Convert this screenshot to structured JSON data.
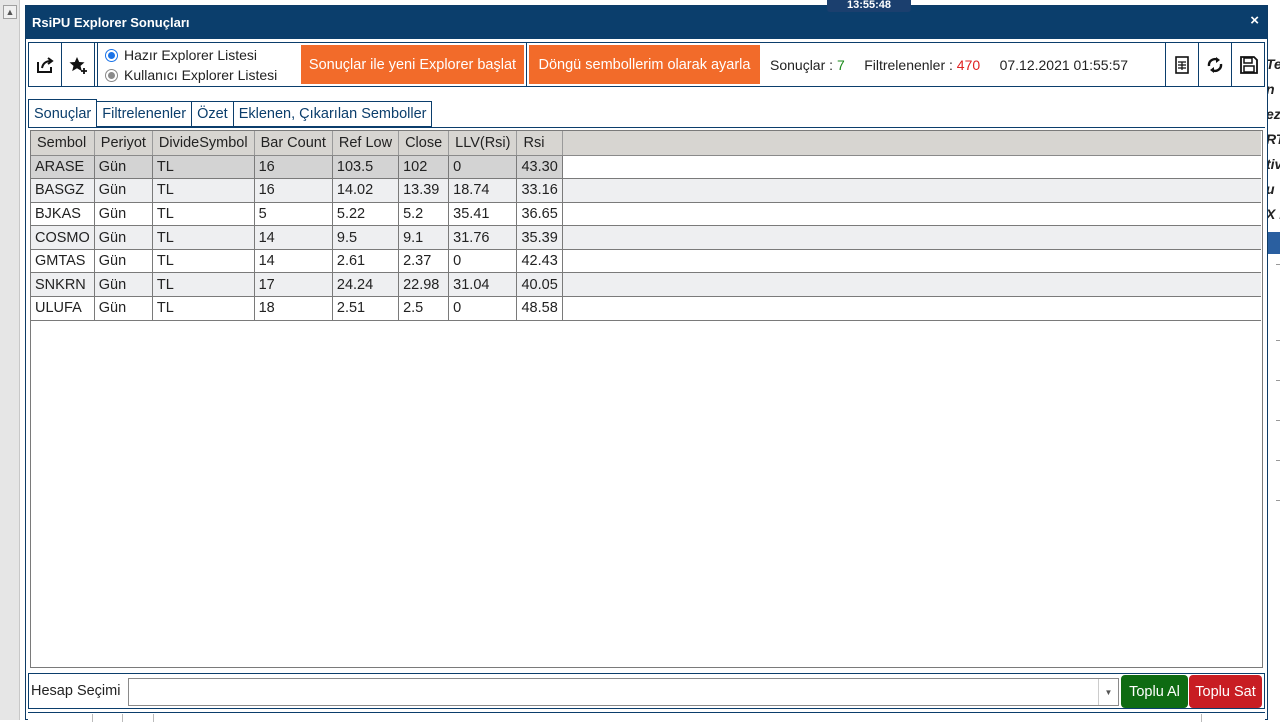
{
  "background": {
    "clock": "13:55:48",
    "right_fragments": [
      "Ter",
      "n",
      "ez",
      "RT",
      "tiv",
      "u",
      "X l"
    ]
  },
  "window": {
    "title": "RsiPU Explorer Sonuçları",
    "close_glyph": "×"
  },
  "toolbar": {
    "export_icon": "export-icon",
    "favorite_icon": "star-add-icon",
    "radio_options": [
      {
        "label": "Hazır Explorer Listesi",
        "checked": true
      },
      {
        "label": "Kullanıcı Explorer Listesi",
        "checked": false
      }
    ],
    "start_explorer_button": "Sonuçlar ile yeni Explorer başlat",
    "set_loop_button": "Döngü sembollerim olarak ayarla",
    "results_label": "Sonuçlar :",
    "results_count": "7",
    "filtered_label": "Filtrelenenler :",
    "filtered_count": "470",
    "datetime": "07.12.2021 01:55:57",
    "icons": [
      "excel-icon",
      "refresh-icon",
      "save-icon"
    ],
    "colors": {
      "accent": "#f26b2a",
      "count_green": "#1a8a1a",
      "count_red": "#e02020"
    }
  },
  "tabs": [
    "Sonuçlar",
    "Filtrelenenler",
    "Özet",
    "Eklenen, Çıkarılan Semboller"
  ],
  "table": {
    "columns": [
      "Sembol",
      "Periyot",
      "DivideSymbol",
      "Bar Count",
      "Ref Low",
      "Close",
      "LLV(Rsi)",
      "Rsi"
    ],
    "rows": [
      [
        "ARASE",
        "Gün",
        "TL",
        "16",
        "103.5",
        "102",
        "0",
        "43.30"
      ],
      [
        "BASGZ",
        "Gün",
        "TL",
        "16",
        "14.02",
        "13.39",
        "18.74",
        "33.16"
      ],
      [
        "BJKAS",
        "Gün",
        "TL",
        "5",
        "5.22",
        "5.2",
        "35.41",
        "36.65"
      ],
      [
        "COSMO",
        "Gün",
        "TL",
        "14",
        "9.5",
        "9.1",
        "31.76",
        "35.39"
      ],
      [
        "GMTAS",
        "Gün",
        "TL",
        "14",
        "2.61",
        "2.37",
        "0",
        "42.43"
      ],
      [
        "SNKRN",
        "Gün",
        "TL",
        "17",
        "24.24",
        "22.98",
        "31.04",
        "40.05"
      ],
      [
        "ULUFA",
        "Gün",
        "TL",
        "18",
        "2.51",
        "2.5",
        "0",
        "48.58"
      ]
    ]
  },
  "bottom": {
    "account_label": "Hesap Seçimi",
    "account_value": "",
    "buy_all_button": "Toplu Al",
    "sell_all_button": "Toplu Sat",
    "colors": {
      "buy": "#0e6b12",
      "sell": "#c81d23"
    }
  }
}
